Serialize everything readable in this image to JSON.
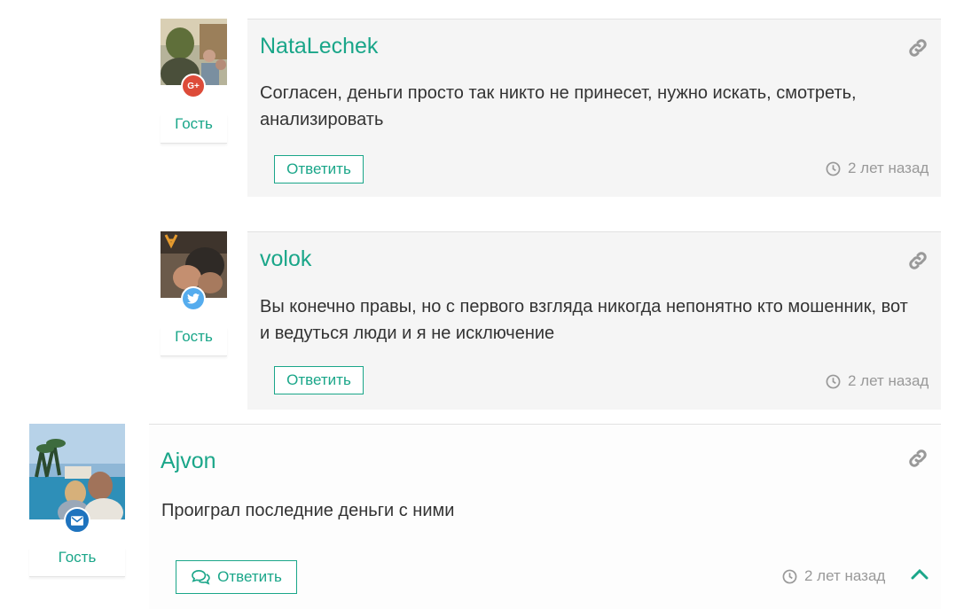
{
  "comments": [
    {
      "author": "NataLechek",
      "role": "Гость",
      "badge": "google-plus-icon",
      "badge_text": "G+",
      "text": "Согласен, деньги просто так никто не принесет, нужно искать, смотреть, анализировать",
      "reply_label": "Ответить",
      "time": "2 лет назад"
    },
    {
      "author": "volok",
      "role": "Гость",
      "badge": "twitter-icon",
      "text": "Вы конечно правы, но с первого взгляда никогда непонятно кто мошенник, вот и ведуться люди и я не исключение",
      "reply_label": "Ответить",
      "time": "2 лет назад"
    },
    {
      "author": "Ajvon",
      "role": "Гость",
      "badge": "email-icon",
      "text": "Проиграл последние деньги с ними",
      "reply_label": "Ответить",
      "time": "2 лет назад"
    }
  ],
  "colors": {
    "accent": "#1aa689",
    "google": "#dd4b39",
    "twitter": "#55acee",
    "email": "#1e73be",
    "muted": "#999999"
  }
}
